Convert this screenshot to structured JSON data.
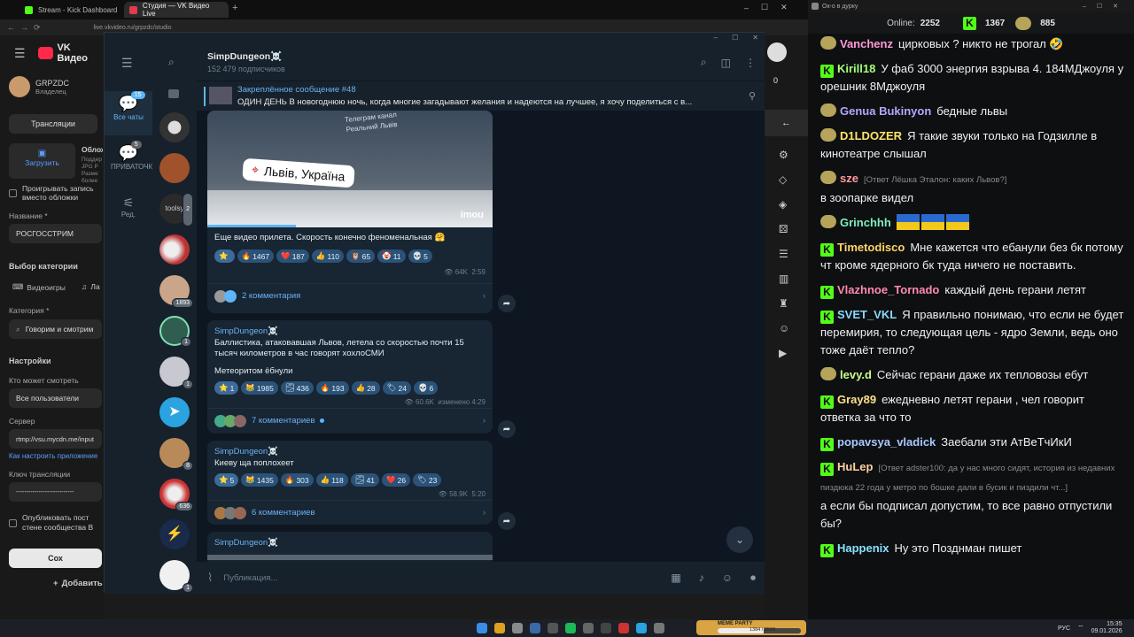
{
  "browser": {
    "tabs": [
      {
        "label": "Stream - Kick Dashboard"
      },
      {
        "label": "Студия — VK Видео Live"
      }
    ],
    "url": "live.vkvideo.ru/grpzdc/studio"
  },
  "vk": {
    "logo": "VK Видео",
    "user": {
      "name": "GRPZDC",
      "role": "Владелец"
    },
    "tab_streams": "Трансляции",
    "upload_label": "Загрузить",
    "cover_title": "Облож",
    "cover_hint": "Поддер JPG P Разме более",
    "play_cover_label": "Проигрывать запись вместо обложки",
    "title_label": "Название *",
    "title_value": "РОСГОССТРИМ",
    "category_section": "Выбор категории",
    "videogames": "Видеоигры",
    "live": "Ла",
    "category_label": "Категория *",
    "category_value": "Говорим и смотрим",
    "settings": "Настройки",
    "who_label": "Кто может смотреть",
    "who_value": "Все пользователи",
    "server_label": "Сервер",
    "server_value": "rtmp://vsu.mycdn.me/input",
    "howto_link": "Как настроить приложение",
    "key_label": "Ключ трансляции",
    "key_value": "----------------------------",
    "publish_label": "Опубликовать пост стене сообщества В",
    "save_btn": "Сох",
    "add_btn": "Добавить",
    "right_count": "0"
  },
  "tg": {
    "folders": [
      {
        "label": "Все чаты",
        "badge": "15",
        "icon": "chat-bubble-icon"
      },
      {
        "label": "ПРИВАТОЧКА",
        "badge": "5",
        "icon": "chat-bubble-icon"
      },
      {
        "label": "Ред.",
        "badge": "",
        "icon": "sliders-icon"
      }
    ],
    "chat_badges": [
      "",
      "",
      "2",
      "",
      "1893",
      "1",
      "1",
      "",
      "8",
      "636",
      "",
      "1"
    ],
    "channel_name": "SimpDungeon☠️",
    "subscribers": "152 479 подписчиков",
    "pinned_title": "Закреплённое сообщение #48",
    "pinned_text": "ОДИН ДЕНЬ  В новогоднюю ночь, когда многие загадывают желания и надеются на лучшее, я хочу поделиться с в...",
    "post1": {
      "overlay_top": "Телеграм канал Реальний Львів",
      "location": "Львів, Україна",
      "brand": "imou",
      "text": "Еще видео прилета. Скорость конечно феноменальная 🤗",
      "reactions": [
        {
          "e": "⭐",
          "n": ""
        },
        {
          "e": "🔥",
          "n": "1467"
        },
        {
          "e": "❤️",
          "n": "187"
        },
        {
          "e": "👍",
          "n": "110"
        },
        {
          "e": "🦉",
          "n": "65"
        },
        {
          "e": "🤡",
          "n": "11"
        },
        {
          "e": "💀",
          "n": "5"
        }
      ],
      "views": "64K",
      "time": "2:59",
      "comments": "2 комментария"
    },
    "post2": {
      "author": "SimpDungeon☠️",
      "text1": "Баллистика, атаковавшая Львов, летела со скоростью почти 15 тысяч километров в час говорят хохлоСМИ",
      "text2": "Метеоритом ёбнули",
      "reactions": [
        {
          "e": "⭐",
          "n": "1"
        },
        {
          "e": "😹",
          "n": "1985"
        },
        {
          "e": "🌫",
          "n": "436"
        },
        {
          "e": "🔥",
          "n": "193"
        },
        {
          "e": "👍",
          "n": "28"
        },
        {
          "e": "🏷",
          "n": "24"
        },
        {
          "e": "💀",
          "n": "6"
        }
      ],
      "views": "60.6K",
      "edited": "изменено 4:29",
      "comments": "7 комментариев"
    },
    "post3": {
      "author": "SimpDungeon☠️",
      "text": "Киеву ща поплохеет",
      "reactions": [
        {
          "e": "⭐",
          "n": "5"
        },
        {
          "e": "😹",
          "n": "1435"
        },
        {
          "e": "🔥",
          "n": "303"
        },
        {
          "e": "👍",
          "n": "118"
        },
        {
          "e": "🌫",
          "n": "41"
        },
        {
          "e": "❤️",
          "n": "26"
        },
        {
          "e": "🏷",
          "n": "23"
        }
      ],
      "views": "58.9K",
      "time": "5:20",
      "comments": "6 комментариев"
    },
    "post4_author": "SimpDungeon☠️",
    "composer_placeholder": "Публикация..."
  },
  "chat": {
    "window_title": "Ок-о в дурку",
    "online_label": "Online:",
    "online_value": "2252",
    "kick_count": "1367",
    "other_count": "885",
    "messages": [
      {
        "user": "Vanchenz",
        "color": "#ff9ad9",
        "badge": "emo",
        "text": "цирковых ? никто не трогал 🤣",
        "reply": ""
      },
      {
        "user": "Kirill18",
        "color": "#a6ff7a",
        "badge": "kick",
        "text": "У фаб 3000 энергия взрыва 4. 184МДжоуля у орешник 8Мджоуля",
        "reply": ""
      },
      {
        "user": "Genua Bukinyon",
        "color": "#b3a8ff",
        "badge": "emo",
        "text": "бедные львы",
        "reply": ""
      },
      {
        "user": "D1LDOZER",
        "color": "#ffe66b",
        "badge": "emo",
        "text": "Я такие звуки только на Годзилле в кинотеатре слышал",
        "reply": ""
      },
      {
        "user": "sze",
        "color": "#ff9a9a",
        "badge": "emo",
        "text": "в зоопарке видел",
        "reply": "[Ответ Лёшка Эталон: каких Львов?]"
      },
      {
        "user": "Grinchhh",
        "color": "#7df0c0",
        "badge": "emo",
        "text": "",
        "reply": ""
      },
      {
        "user": "Timetodisco",
        "color": "#ffd36b",
        "badge": "kick",
        "text": "Мне кажется что ебанули без бк потому чт кроме ядерного бк туда ничего не поставить.",
        "reply": ""
      },
      {
        "user": "Vlazhnoe_Tornado",
        "color": "#ff8ab0",
        "badge": "kick",
        "text": "каждый день герани летят",
        "reply": ""
      },
      {
        "user": "SVET_VKL",
        "color": "#8ad8ff",
        "badge": "kick",
        "text": "Я правильно понимаю, что если не будет перемирия, то следующая цель - ядро Земли, ведь оно тоже даёт тепло?",
        "reply": ""
      },
      {
        "user": "levy.d",
        "color": "#c8ff8a",
        "badge": "emo",
        "text": "Сейчас герани даже их тепловозы ебут",
        "reply": ""
      },
      {
        "user": "Gray89",
        "color": "#ffe08a",
        "badge": "kick",
        "text": "ежедневно летят герани , чел говорит ответка за что то",
        "reply": ""
      },
      {
        "user": "popavsya_vladick",
        "color": "#a8c8ff",
        "badge": "kick",
        "text": "Заебали эти АтВеТчИкИ",
        "reply": ""
      },
      {
        "user": "HuLep",
        "color": "#ffd0a0",
        "badge": "kick",
        "text": "а если бы подписал допустим, то все равно отпустили бы?",
        "reply": "[Ответ adster100: да у нас много сидят, история из недавних пиздюка 22 года у метро по бошке дали в бусик и пиздили чт...]"
      },
      {
        "user": "Happenix",
        "color": "#8ae0ff",
        "badge": "kick",
        "text": "Ну это Позднман пишет",
        "reply": ""
      }
    ]
  },
  "taskbar": {
    "meme_label": "MEME PARTY",
    "meme_progress": "1384 / 2500",
    "lang": "РУС",
    "time": "15:35",
    "date": "09.01.2026"
  }
}
